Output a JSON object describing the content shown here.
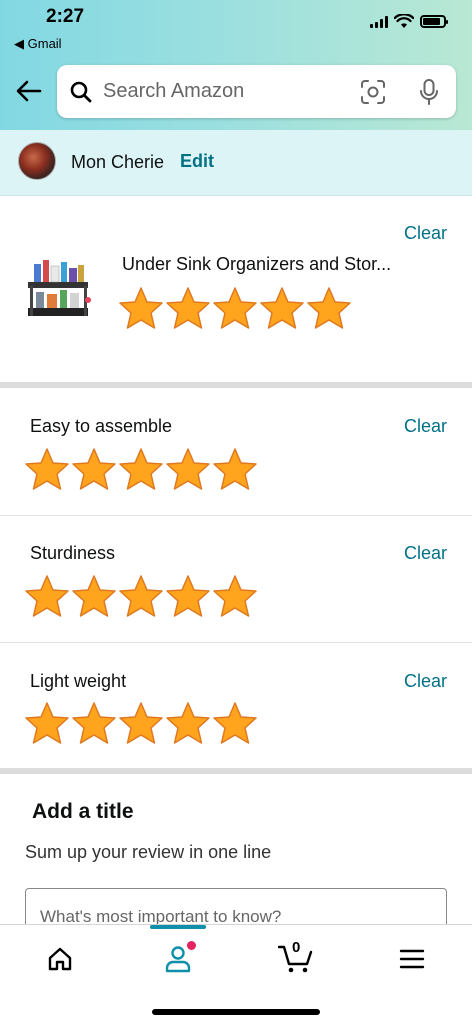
{
  "status_bar": {
    "time": "2:27",
    "back_app": "Gmail"
  },
  "search": {
    "placeholder": "Search Amazon"
  },
  "profile": {
    "name": "Mon Cherie",
    "edit_label": "Edit"
  },
  "product": {
    "clear_label": "Clear",
    "title": "Under Sink Organizers and Stor...",
    "rating": 5,
    "max_rating": 5
  },
  "attributes": [
    {
      "label": "Easy to assemble",
      "clear_label": "Clear",
      "rating": 5
    },
    {
      "label": "Sturdiness",
      "clear_label": "Clear",
      "rating": 5
    },
    {
      "label": "Light weight",
      "clear_label": "Clear",
      "rating": 5
    }
  ],
  "title_section": {
    "heading": "Add a title",
    "subheading": "Sum up your review in one line",
    "placeholder": "What's most important to know?"
  },
  "bottom_nav": {
    "items": [
      "home-icon",
      "account-icon",
      "cart-icon",
      "menu-icon"
    ],
    "cart_count": "0",
    "active": "account-icon",
    "accent_color": "#0f8faa",
    "badge_color": "#e3245e"
  },
  "colors": {
    "link": "#007185",
    "star": "#ffa41c"
  }
}
